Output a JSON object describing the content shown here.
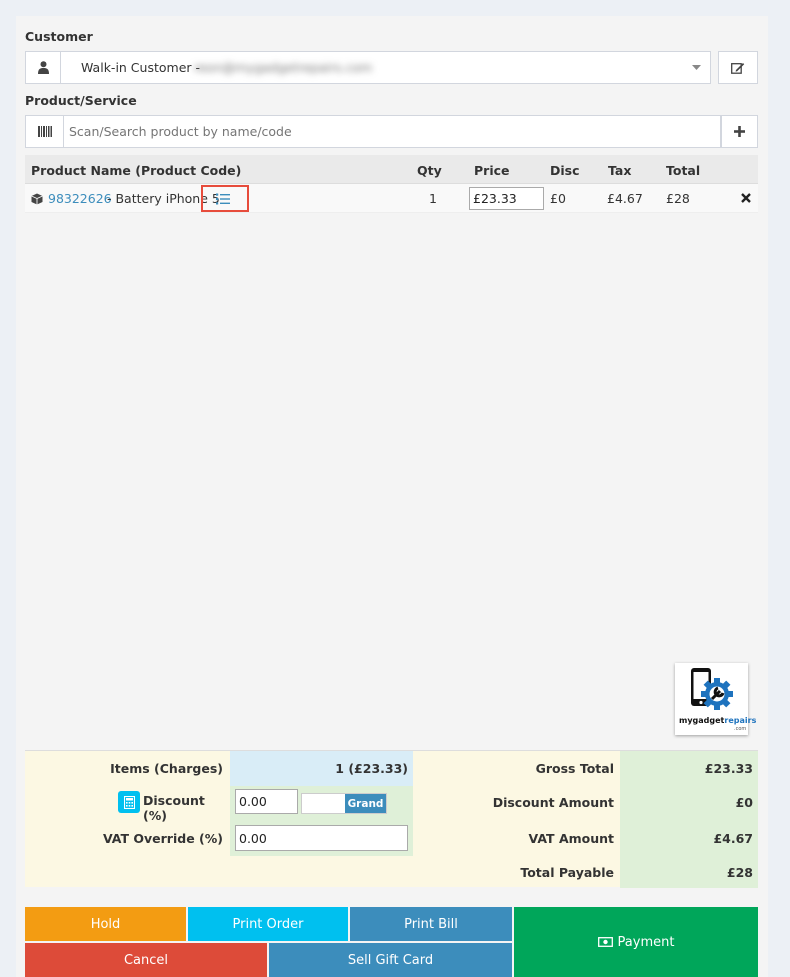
{
  "customer": {
    "label": "Customer",
    "selected": "Walk-in Customer -",
    "email_blurred": "reon@mygadgetrepairs.com"
  },
  "product": {
    "label": "Product/Service",
    "search_placeholder": "Scan/Search product by name/code"
  },
  "table": {
    "headers": {
      "name": "Product Name (Product Code)",
      "qty": "Qty",
      "price": "Price",
      "disc": "Disc",
      "tax": "Tax",
      "total": "Total"
    },
    "rows": [
      {
        "code": "98322626",
        "name": "- Battery iPhone 5",
        "qty": "1",
        "price": "£23.33",
        "disc": "£0",
        "tax": "£4.67",
        "total": "£28"
      }
    ]
  },
  "logo": {
    "text_a": "mygadget",
    "text_b": "repairs",
    "sub": ".com"
  },
  "summary": {
    "items_label": "Items (Charges)",
    "items_value": "1 (£23.33)",
    "discount_label": "Discount (%)",
    "discount_value": "0.00",
    "discount_type": "Grand",
    "vat_label": "VAT Override (%)",
    "vat_value": "0.00",
    "gross_label": "Gross Total",
    "gross_value": "£23.33",
    "discount_amount_label": "Discount Amount",
    "discount_amount_value": "£0",
    "vat_amount_label": "VAT Amount",
    "vat_amount_value": "£4.67",
    "total_label": "Total Payable",
    "total_value": "£28"
  },
  "buttons": {
    "hold": "Hold",
    "print_order": "Print Order",
    "print_bill": "Print Bill",
    "payment": "Payment",
    "cancel": "Cancel",
    "sell_gift_card": "Sell Gift Card"
  },
  "colors": {
    "hold": "#f39c12",
    "print_order": "#00c0ef",
    "print_bill": "#3c8dbc",
    "payment": "#00a65a",
    "cancel": "#dd4b39",
    "link": "#3c8dbc",
    "highlight": "#e74c3c"
  }
}
